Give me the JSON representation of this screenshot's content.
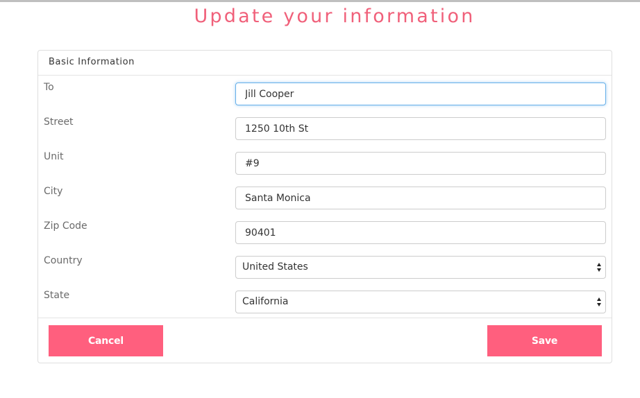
{
  "page": {
    "title": "Update your information"
  },
  "panel": {
    "heading": "Basic Information"
  },
  "fields": [
    {
      "label": "To",
      "value": "Jill Cooper"
    },
    {
      "label": "Street",
      "value": "1250 10th St"
    },
    {
      "label": "Unit",
      "value": "#9"
    },
    {
      "label": "City",
      "value": "Santa Monica"
    },
    {
      "label": "Zip Code",
      "value": "90401"
    }
  ],
  "selects": [
    {
      "label": "Country",
      "selected": "United States"
    },
    {
      "label": "State",
      "selected": "California"
    }
  ],
  "buttons": {
    "cancel": "Cancel",
    "save": "Save"
  },
  "colors": {
    "accent": "#ff5f7e",
    "title": "#f0607a",
    "focus": "#66afe9"
  }
}
